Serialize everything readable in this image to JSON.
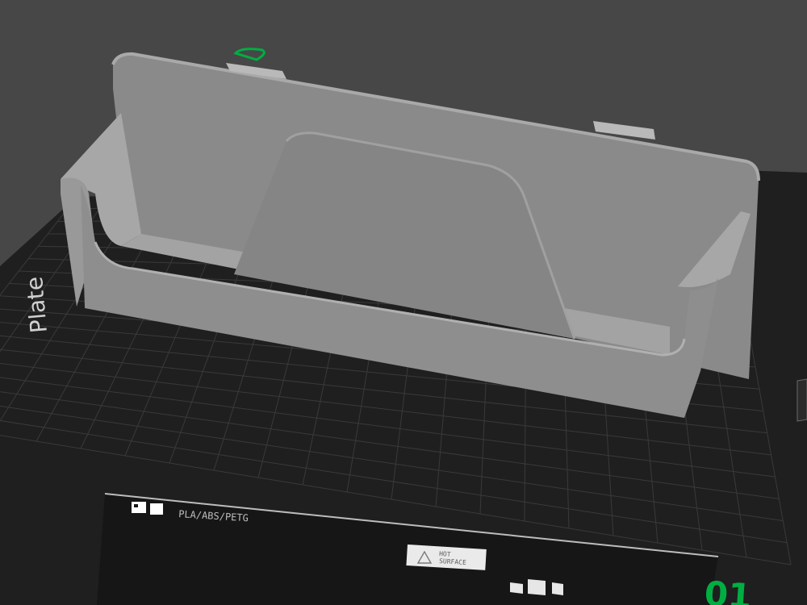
{
  "viewport": {
    "background": "#474747",
    "colors": {
      "bed": "#1f1f1f",
      "grid": "#3a3a3a",
      "model": "#8f8f8f",
      "model_shadow": "#6f6f6f",
      "accent_green": "#00ae42"
    }
  },
  "bed": {
    "side_text": "Plate",
    "material_label": "PLA/ABS/PETG",
    "hot_surface": [
      "HOT",
      "SURFACE"
    ],
    "plate_number": "01"
  },
  "icons": {
    "grid_icon": "grid-icon",
    "warning_icon": "warning-triangle-icon",
    "plate_marker": "plate-marker-icon"
  }
}
